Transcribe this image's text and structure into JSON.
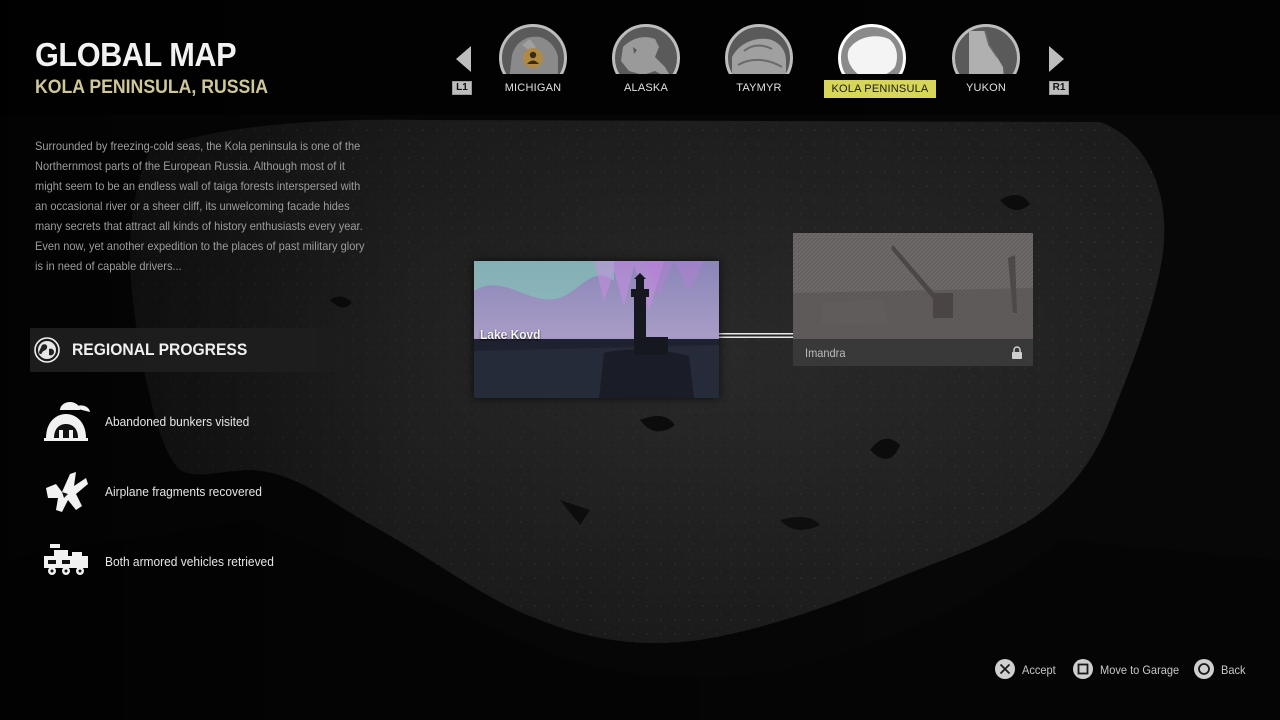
{
  "header": {
    "title": "GLOBAL MAP",
    "subtitle": "KOLA PENINSULA, RUSSIA"
  },
  "description": "Surrounded by freezing-cold seas, the Kola peninsula is one of the Northernmost parts of the European Russia. Although most of it might seem to be an endless wall of taiga forests interspersed with an occasional river or a sheer cliff, its unwelcoming facade hides many secrets that attract all kinds of history enthusiasts every year. Even now, yet another expedition to the places of past military glory is in need of capable drivers...",
  "region_nav": {
    "prev_button": "L1",
    "next_button": "R1",
    "regions": [
      {
        "label": "MICHIGAN",
        "active": false
      },
      {
        "label": "ALASKA",
        "active": false
      },
      {
        "label": "TAYMYR",
        "active": false
      },
      {
        "label": "KOLA PENINSULA",
        "active": true
      },
      {
        "label": "YUKON",
        "active": false
      }
    ]
  },
  "regional_progress": {
    "title": "REGIONAL PROGRESS",
    "icon": "globe-icon",
    "objectives": [
      {
        "icon": "bunker-icon",
        "label": "Abandoned bunkers visited"
      },
      {
        "icon": "airplane-fragment-icon",
        "label": "Airplane fragments recovered"
      },
      {
        "icon": "armored-vehicle-icon",
        "label": "Both armored vehicles retrieved"
      }
    ]
  },
  "maps": [
    {
      "name": "Lake Kovd",
      "locked": false
    },
    {
      "name": "Imandra",
      "locked": true
    }
  ],
  "controls": [
    {
      "button": "cross-button-icon",
      "label": "Accept"
    },
    {
      "button": "square-button-icon",
      "label": "Move to Garage"
    },
    {
      "button": "circle-button-icon",
      "label": "Back"
    }
  ],
  "colors": {
    "accent": "#d8d65a",
    "subtitle": "#cfc79a",
    "background": "#070707"
  }
}
